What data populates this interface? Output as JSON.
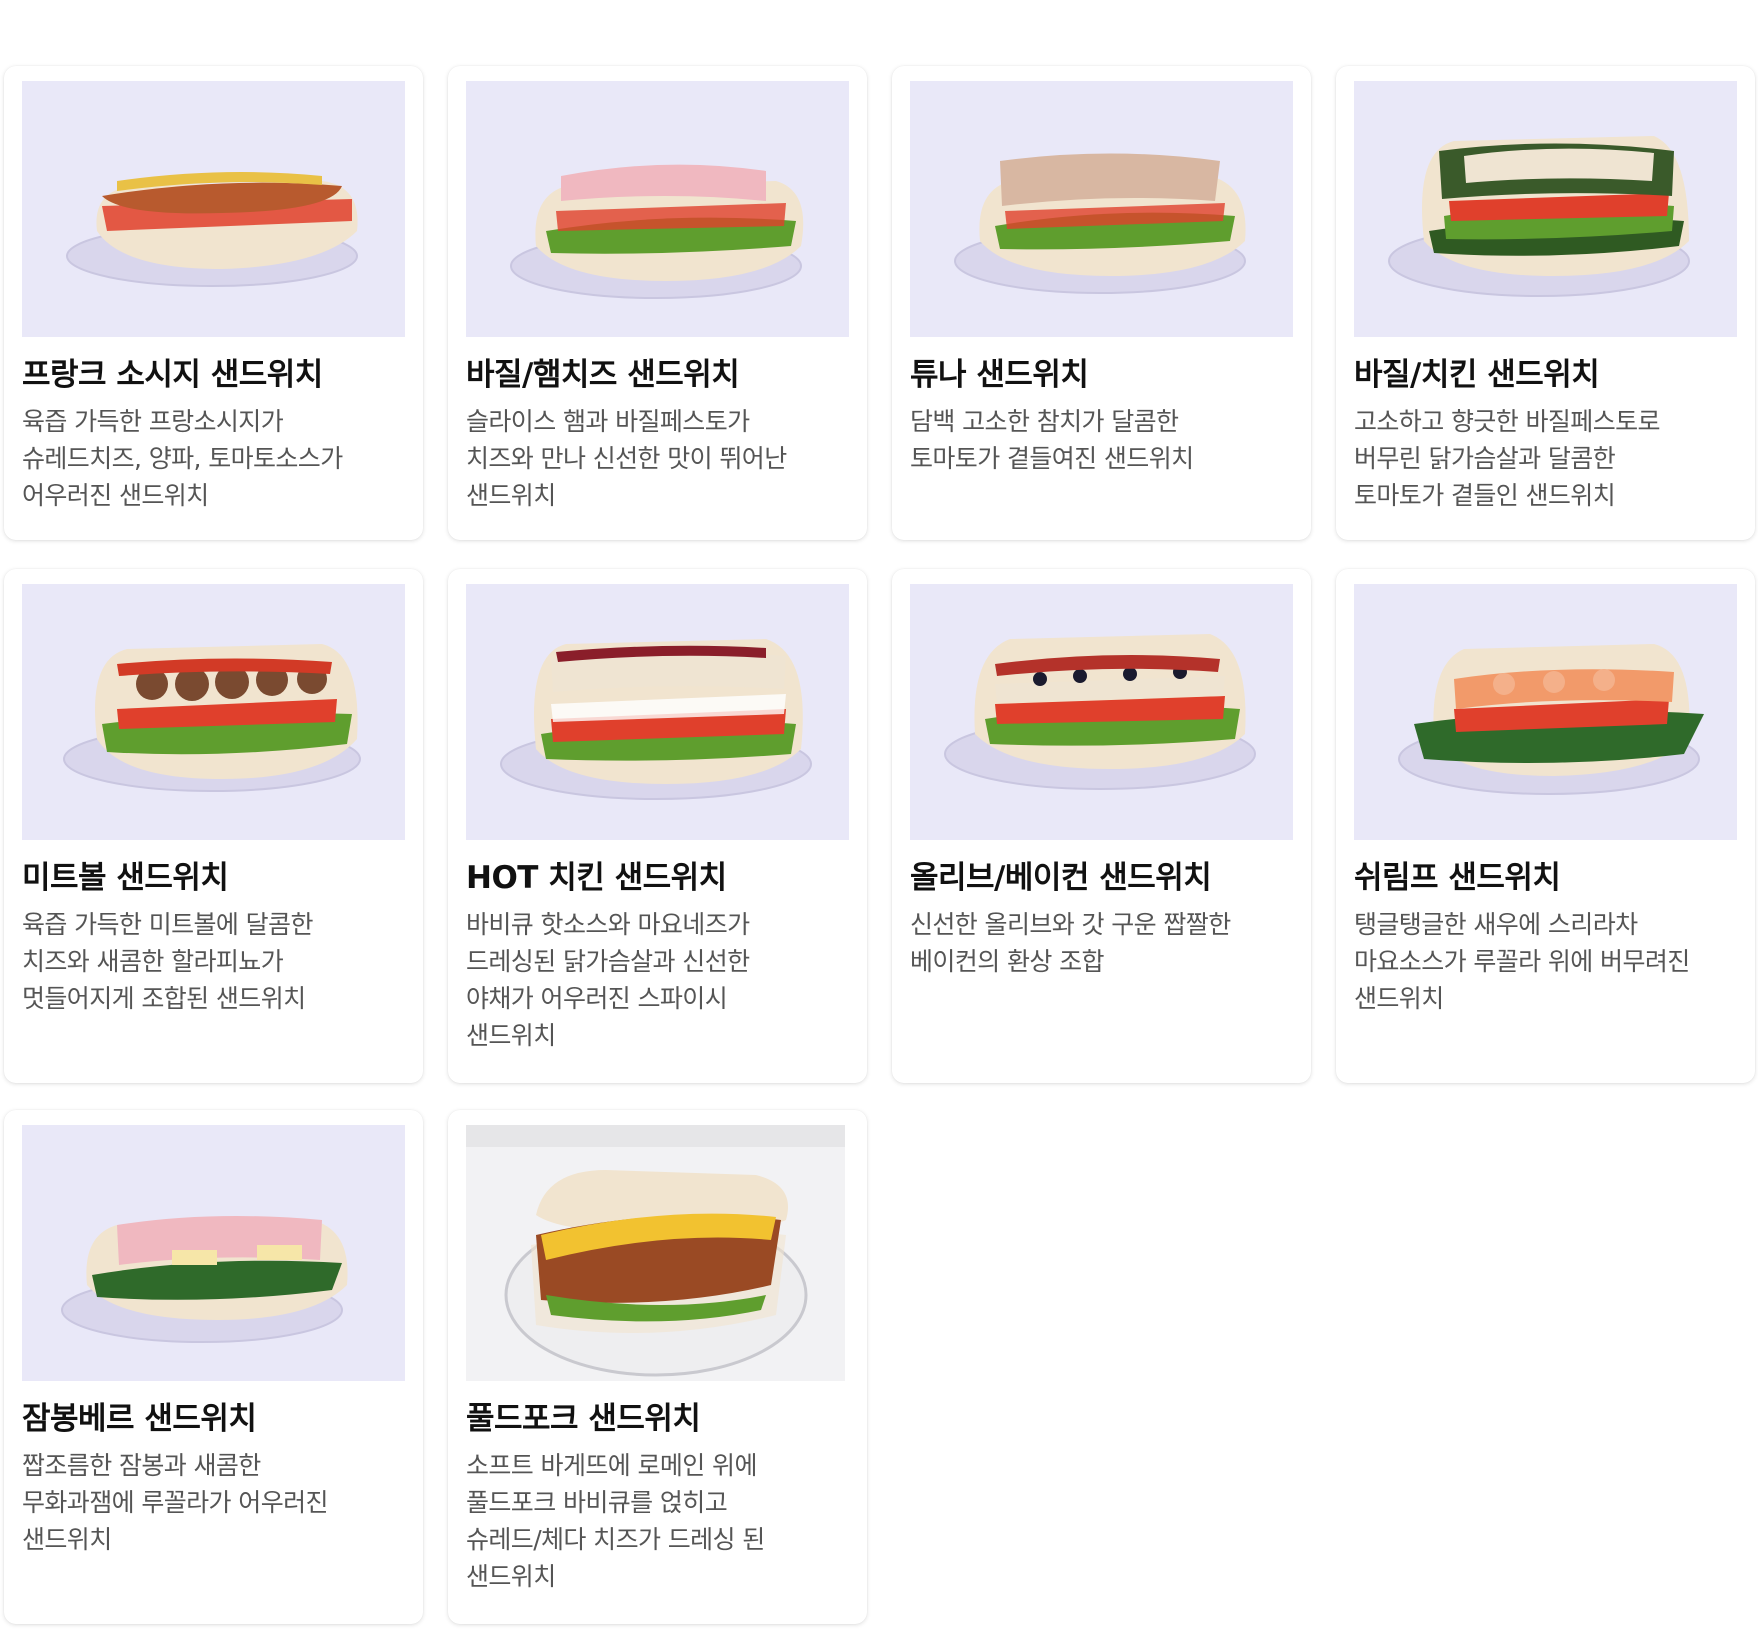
{
  "menu": {
    "items": [
      {
        "name": "프랑크 소시지 샌드위치",
        "desc": "육즙 가득한 프랑소시지가\n슈레드치즈, 양파, 토마토소스가\n어우러진 샌드위치",
        "image": "frank-sausage-sandwich-photo"
      },
      {
        "name": "바질/햄치즈 샌드위치",
        "desc": "슬라이스 햄과 바질페스토가\n치즈와 만나 신선한 맛이 뛰어난\n샌드위치",
        "image": "basil-ham-cheese-sandwich-photo"
      },
      {
        "name": "튜나 샌드위치",
        "desc": "담백 고소한 참치가 달콤한\n토마토가 곁들여진 샌드위치",
        "image": "tuna-sandwich-photo"
      },
      {
        "name": "바질/치킨 샌드위치",
        "desc": "고소하고 향긋한 바질페스토로\n버무린 닭가슴살과 달콤한\n토마토가 곁들인 샌드위치",
        "image": "basil-chicken-sandwich-photo"
      },
      {
        "name": "미트볼 샌드위치",
        "desc": "육즙 가득한 미트볼에 달콤한\n치즈와 새콤한 할라피뇨가\n멋들어지게 조합된 샌드위치",
        "image": "meatball-sandwich-photo"
      },
      {
        "name": "HOT 치킨 샌드위치",
        "desc": "바비큐 핫소스와 마요네즈가\n드레싱된 닭가슴살과 신선한\n야채가 어우러진 스파이시\n샌드위치",
        "image": "hot-chicken-sandwich-photo"
      },
      {
        "name": "올리브/베이컨 샌드위치",
        "desc": "신선한 올리브와 갓 구운 짭짤한\n베이컨의 환상 조합",
        "image": "olive-bacon-sandwich-photo"
      },
      {
        "name": "쉬림프 샌드위치",
        "desc": "탱글탱글한 새우에 스리라차\n마요소스가 루꼴라 위에 버무려진\n샌드위치",
        "image": "shrimp-sandwich-photo"
      },
      {
        "name": "잠봉베르 샌드위치",
        "desc": "짭조름한 잠봉과 새콤한\n무화과잼에 루꼴라가 어우러진\n샌드위치",
        "image": "jambon-beurre-sandwich-photo"
      },
      {
        "name": "풀드포크 샌드위치",
        "desc": "소프트 바게뜨에 로메인 위에\n풀드포크 바비큐를 얹히고\n슈레드/체다 치즈가 드레싱 된\n샌드위치",
        "image": "pulled-pork-sandwich-photo"
      }
    ]
  },
  "colors": {
    "photo_bg": "#e9e8f8",
    "photo_bg_alt": "#f2f2f4",
    "bread": "#f1e4cf",
    "lettuce": "#5f9e2e",
    "tomato": "#e0402c",
    "text_title": "#111111",
    "text_desc": "#555555"
  }
}
